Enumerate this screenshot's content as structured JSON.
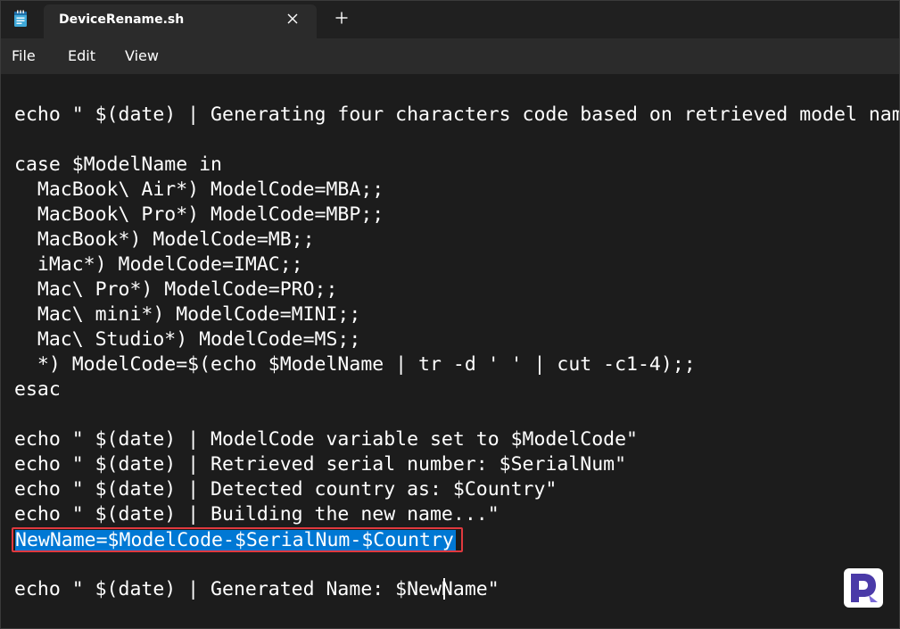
{
  "tab": {
    "title": "DeviceRename.sh",
    "app_icon": "notepad-icon",
    "close_icon": "close-icon",
    "new_tab_icon": "plus-icon"
  },
  "menu": {
    "items": [
      "File",
      "Edit",
      "View"
    ]
  },
  "code": {
    "lines": [
      "echo \" $(date) | Generating four characters code based on retrieved model name\"",
      "",
      "case $ModelName in",
      "  MacBook\\ Air*) ModelCode=MBA;;",
      "  MacBook\\ Pro*) ModelCode=MBP;;",
      "  MacBook*) ModelCode=MB;;",
      "  iMac*) ModelCode=IMAC;;",
      "  Mac\\ Pro*) ModelCode=PRO;;",
      "  Mac\\ mini*) ModelCode=MINI;;",
      "  Mac\\ Studio*) ModelCode=MS;;",
      "  *) ModelCode=$(echo $ModelName | tr -d ' ' | cut -c1-4);;",
      "esac",
      "",
      "echo \" $(date) | ModelCode variable set to $ModelCode\"",
      "echo \" $(date) | Retrieved serial number: $SerialNum\"",
      "echo \" $(date) | Detected country as: $Country\"",
      "echo \" $(date) | Building the new name...\"",
      "NewName=$ModelCode-$SerialNum-$Country",
      "",
      "echo \" $(date) | Generated Name: $NewName\""
    ]
  },
  "colors": {
    "background": "#1c1c1c",
    "selection": "#0078d4",
    "highlight_border": "#e0393e"
  },
  "watermark": {
    "icon": "prajwal-logo-icon"
  }
}
